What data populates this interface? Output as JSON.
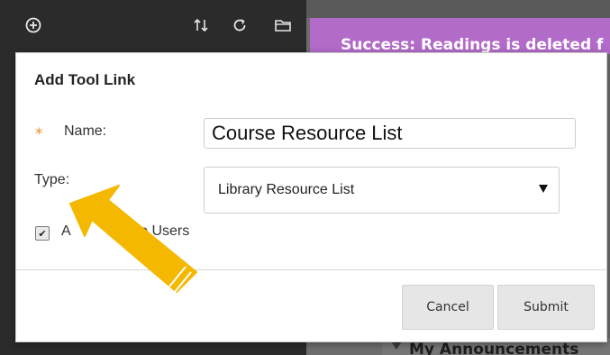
{
  "toolbar": {
    "icons": [
      "add-circle-icon",
      "sort-icon",
      "refresh-icon",
      "folder-icon"
    ]
  },
  "notice": {
    "text": "Success: Readings is deleted f"
  },
  "partial_section": {
    "label": "My Announcements"
  },
  "dialog": {
    "title": "Add Tool Link",
    "name_required_marker": "*",
    "name_label": "Name:",
    "name_value": "Course Resource List",
    "type_label": "Type:",
    "type_selected": "Library Resource List",
    "available_label_visible": "A",
    "available_label_suffix": "to Users",
    "available_checked": true,
    "cancel_label": "Cancel",
    "submit_label": "Submit"
  },
  "colors": {
    "menu_bg": "#2b2b2b",
    "success_bg": "#b36bc9",
    "required_star": "#e8902a",
    "arrow_fill": "#f5b800",
    "button_bg": "#e6e6e6"
  },
  "annotation": {
    "icon": "yellow-arrow-icon"
  }
}
